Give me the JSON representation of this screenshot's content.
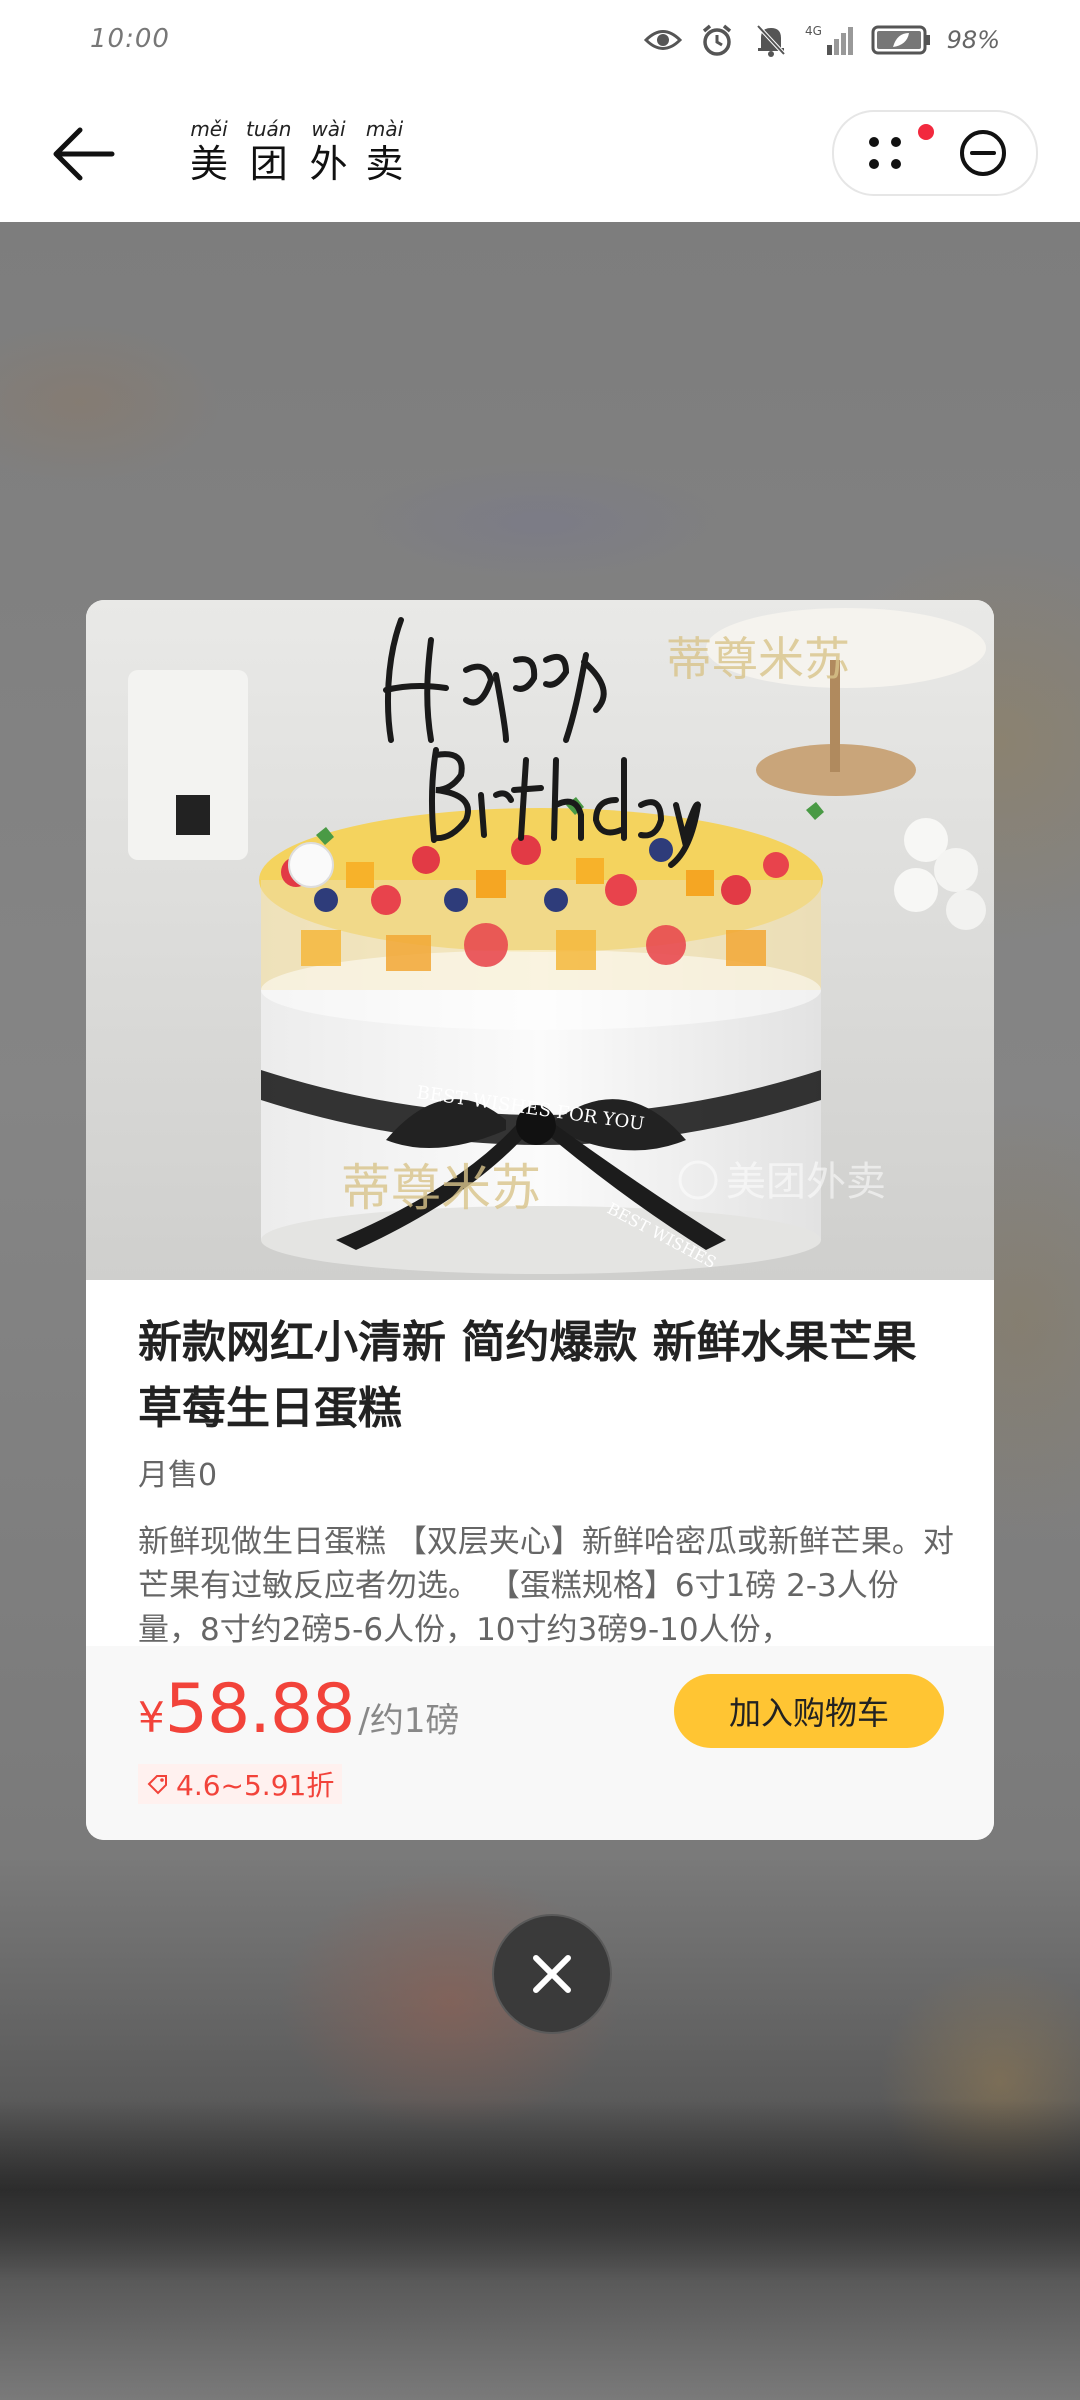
{
  "status_bar": {
    "time": "10:00",
    "network": "4G",
    "battery": "98%",
    "icons": [
      "eye-icon",
      "alarm-icon",
      "mute-bell-icon",
      "signal-icon",
      "battery-icon"
    ]
  },
  "nav": {
    "back_icon": "back-arrow-icon",
    "brand_pinyin": [
      "měi",
      "tuán",
      "wài",
      "mài"
    ],
    "brand_chars": [
      "美",
      "团",
      "外",
      "卖"
    ],
    "more_icon": "more-dots-icon",
    "minimize_icon": "minimize-circle-icon"
  },
  "product": {
    "image_watermark_brand": "蒂尊米苏",
    "image_watermark_app": "美团外卖",
    "title": "新款网红小清新 简约爆款 新鲜水果芒果草莓生日蛋糕",
    "monthly_sales": "月售0",
    "description": "新鲜现做生日蛋糕 【双层夹心】新鲜哈密瓜或新鲜芒果。对芒果有过敏反应者勿选。 【蛋糕规格】6寸1磅 2-3人份量，8寸约2磅5-6人份，10寸约3磅9-10人份，",
    "price_symbol": "¥",
    "price": "58.88",
    "price_unit": "/约1磅",
    "discount": "4.6~5.91折",
    "add_to_cart": "加入购物车"
  },
  "colors": {
    "price_red": "#f2433a",
    "cart_yellow": "#ffc533",
    "notify_red": "#f2293e"
  }
}
